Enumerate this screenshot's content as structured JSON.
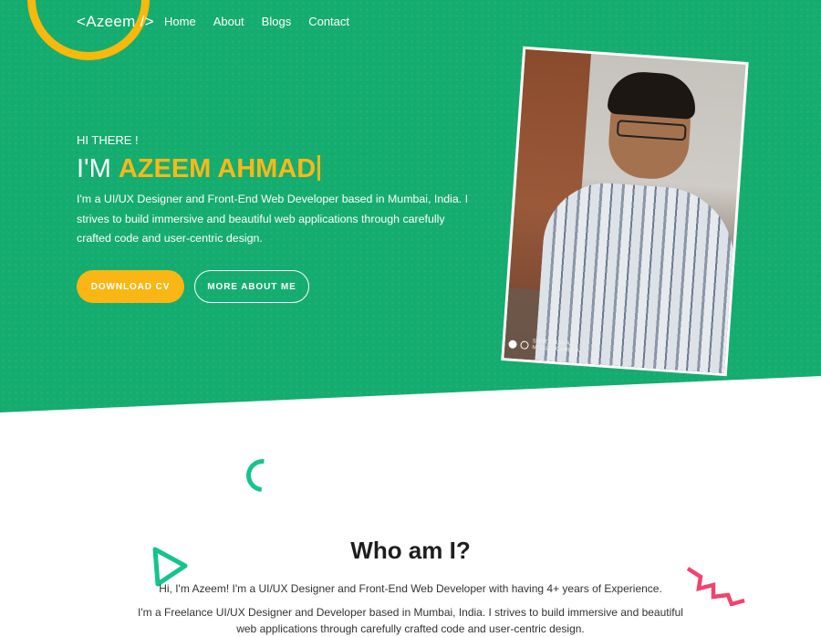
{
  "brand": {
    "logo": "<Azeem />",
    "accent": "#15ac6f",
    "highlight": "#fbb817"
  },
  "nav": {
    "items": [
      "Home",
      "About",
      "Blogs",
      "Contact"
    ]
  },
  "hero": {
    "greeting": "HI THERE !",
    "prefix": "I'M ",
    "name": "AZEEM AHMAD",
    "intro": "I'm a UI/UX Designer and Front-End Web Developer based in Mumbai, India. I strives to build immersive and beautiful web applications through carefully crafted code and user-centric design.",
    "buttons": {
      "download": "DOWNLOAD CV",
      "more": "MORE ABOUT ME"
    },
    "photo_watermark": {
      "line1": "SHOT ON MI A1",
      "line2": "MI DUAL CAMERA"
    }
  },
  "about": {
    "title": "Who am I?",
    "line1": "Hi, I'm Azeem! I'm a UI/UX Designer and Front-End Web Developer with having 4+ years of Experience.",
    "line2": "I'm a Freelance UI/UX Designer and Developer based in Mumbai, India. I strives to build immersive and beautiful web applications through carefully crafted code and user-centric design."
  },
  "icons": {
    "decor_arc": "arc-decoration-icon",
    "decor_triangle": "triangle-decoration-icon",
    "decor_zigzag": "zigzag-decoration-icon"
  }
}
